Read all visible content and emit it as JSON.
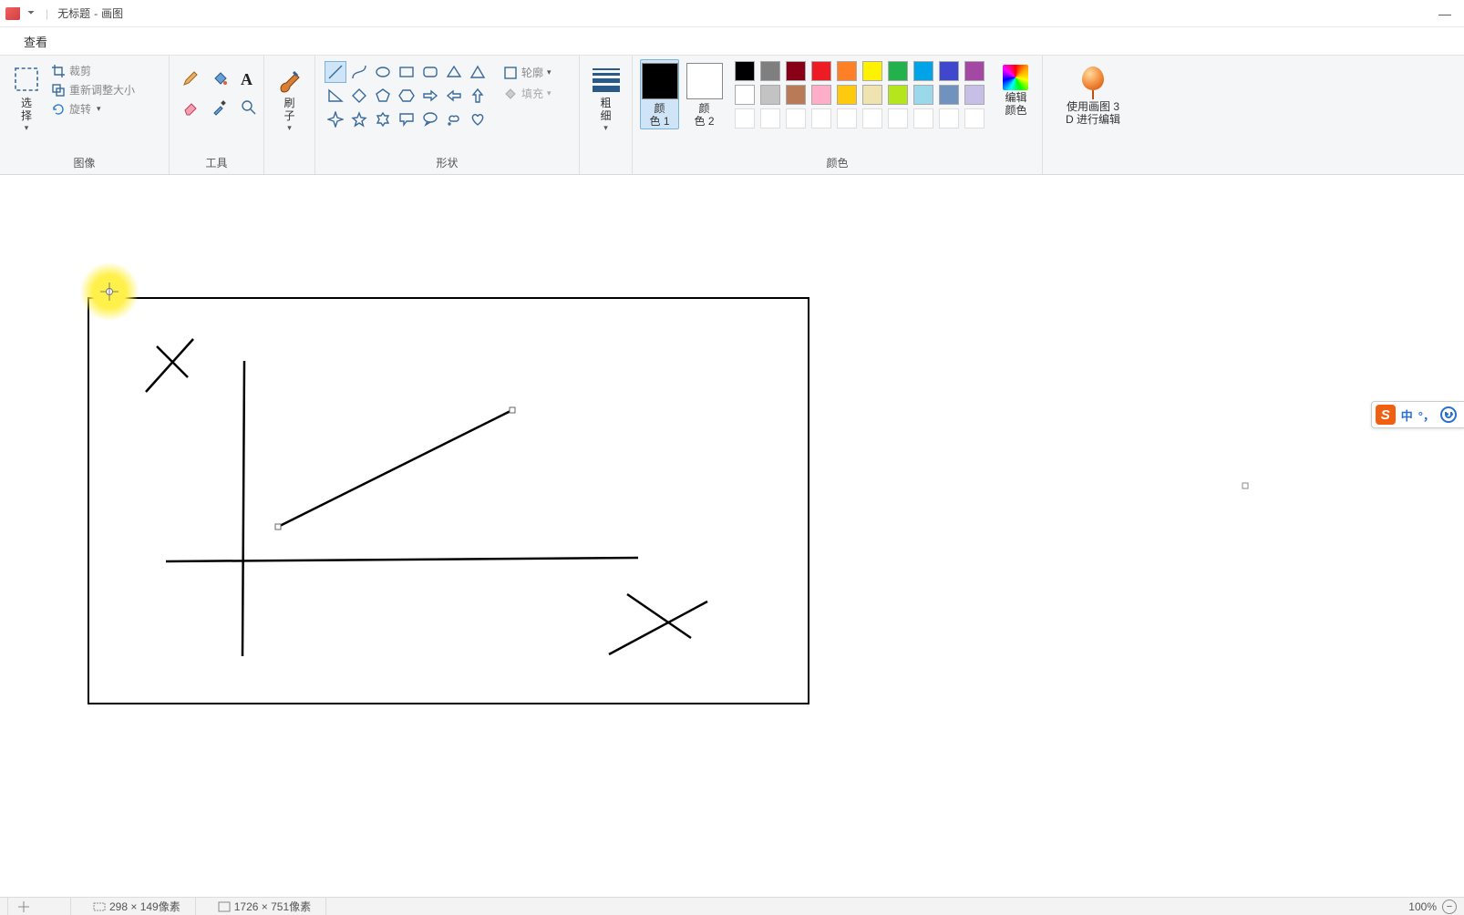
{
  "title": {
    "document": "无标题",
    "app": "画图"
  },
  "tabs": {
    "view": "查看"
  },
  "ribbon": {
    "image": {
      "select": "选\n择",
      "crop": "裁剪",
      "resize": "重新调整大小",
      "rotate": "旋转",
      "group": "图像"
    },
    "tools": {
      "group": "工具"
    },
    "brushes": {
      "label": "刷\n子"
    },
    "shapes": {
      "outline": "轮廓",
      "fill": "填充",
      "group": "形状"
    },
    "size": {
      "label": "粗\n细"
    },
    "colors": {
      "color1": "颜\n色 1",
      "color2": "颜\n色 2",
      "edit": "编辑\n颜色",
      "group": "颜色",
      "color1_value": "#000000",
      "color2_value": "#ffffff",
      "palette_row1": [
        "#000000",
        "#7f7f7f",
        "#880015",
        "#ed1c24",
        "#ff7f27",
        "#fff200",
        "#22b14c",
        "#00a2e8",
        "#3f48cc",
        "#a349a4"
      ],
      "palette_row2": [
        "#ffffff",
        "#c3c3c3",
        "#b97a57",
        "#ffaec9",
        "#ffc90e",
        "#efe4b0",
        "#b5e61d",
        "#99d9ea",
        "#7092be",
        "#c8bfe7"
      ]
    },
    "paint3d": {
      "label": "使用画图 3\nD 进行编辑"
    }
  },
  "ime": {
    "lang": "中",
    "punct": "°，"
  },
  "status": {
    "selection_size": "298 × 149像素",
    "canvas_size": "1726 × 751像素",
    "zoom": "100%"
  }
}
